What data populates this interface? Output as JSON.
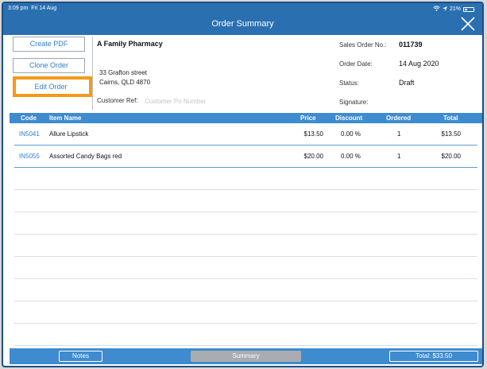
{
  "status_bar": {
    "time": "3:09 pm",
    "date": "Fri 14 Aug",
    "battery": "21%"
  },
  "nav": {
    "title": "Order Summary"
  },
  "actions": {
    "create_pdf": "Create PDF",
    "clone_order": "Clone Order",
    "edit_order": "Edit Order"
  },
  "customer": {
    "name": "A Family Pharmacy",
    "address_line1": "33 Grafton street",
    "address_line2": "Cairns, QLD 4870",
    "ref_label": "Customer Ref:",
    "ref_placeholder": "Customer Po Number"
  },
  "order_meta": {
    "sales_order_label": "Sales Order No.:",
    "sales_order_value": "011739",
    "order_date_label": "Order Date:",
    "order_date_value": "14 Aug 2020",
    "status_label": "Status:",
    "status_value": "Draft",
    "signature_label": "Signature:"
  },
  "table": {
    "headers": {
      "code": "Code",
      "item_name": "Item Name",
      "price": "Price",
      "discount": "Discount",
      "ordered": "Ordered",
      "total": "Total"
    },
    "rows": [
      {
        "code": "IN5041",
        "item_name": "Allure Lipstick",
        "price": "$13.50",
        "discount": "0.00 %",
        "ordered": "1",
        "total": "$13.50"
      },
      {
        "code": "IN5055",
        "item_name": "Assorted Candy Bags red",
        "price": "$20.00",
        "discount": "0.00 %",
        "ordered": "1",
        "total": "$20.00"
      }
    ]
  },
  "bottom_bar": {
    "notes": "Notes",
    "summary": "Summary",
    "total": "Total: $33.50"
  },
  "colors": {
    "brand_blue": "#2a70b1",
    "header_blue": "#3e8bd0",
    "link_blue": "#2f7fd0",
    "highlight_orange": "#f39a19"
  }
}
